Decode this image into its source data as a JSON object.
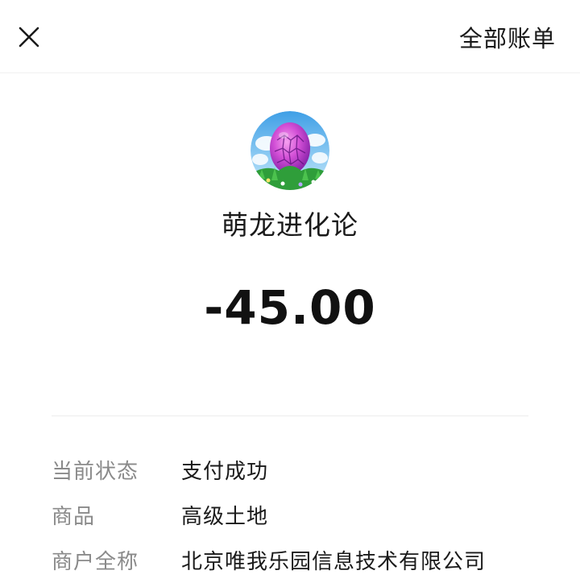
{
  "header": {
    "close_icon": "close-icon",
    "all_bills_label": "全部账单"
  },
  "merchant": {
    "avatar_icon": "purple-dragon-egg",
    "name": "萌龙进化论"
  },
  "amount": "-45.00",
  "details": [
    {
      "label": "当前状态",
      "value": "支付成功"
    },
    {
      "label": "商品",
      "value": "高级土地"
    },
    {
      "label": "商户全称",
      "value": "北京唯我乐园信息技术有限公司"
    }
  ],
  "colors": {
    "background": "#ffffff",
    "text_primary": "#1a1a1a",
    "text_secondary": "#8a8a8a",
    "divider": "#ececec"
  }
}
